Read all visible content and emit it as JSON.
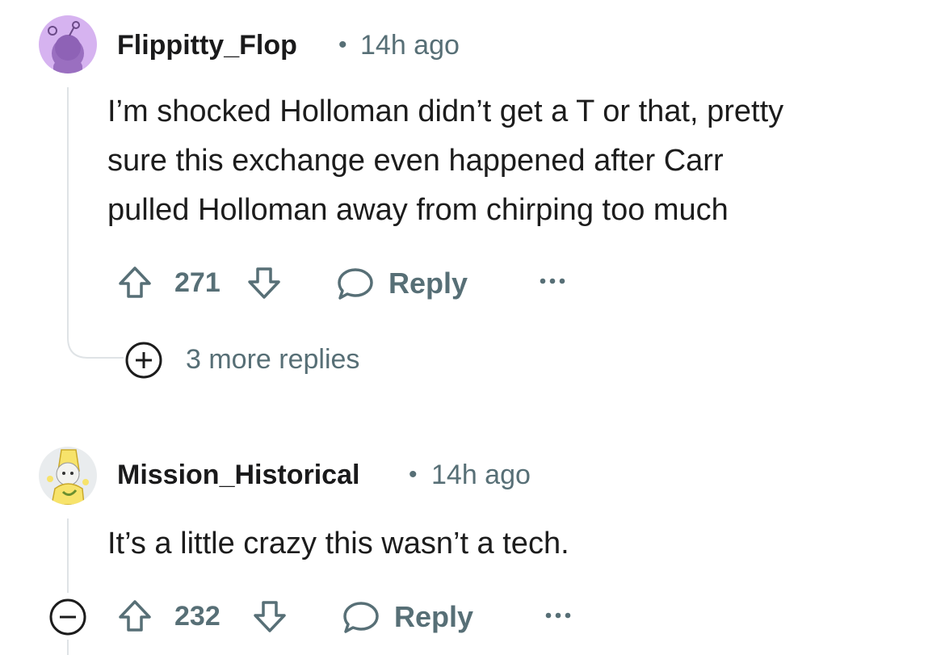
{
  "comments": [
    {
      "username": "Flippitty_Flop",
      "separator": "•",
      "time": "14h ago",
      "text_lines": [
        "I’m shocked Holloman didn’t get a T or that, pretty",
        "sure this exchange even happened after Carr",
        "pulled Holloman away from chirping too much"
      ],
      "score": "271",
      "reply_label": "Reply",
      "more_replies_label": "3 more replies",
      "avatar_icon": "snoo-avatar-icon",
      "avatar_color": "#d6b3f0"
    },
    {
      "username": "Mission_Historical",
      "separator": "•",
      "time": "14h ago",
      "text": "It’s a little crazy this wasn’t a tech.",
      "score": "232",
      "reply_label": "Reply",
      "avatar_icon": "banana-snoo-avatar-icon"
    }
  ],
  "icons": {
    "upvote": "arrow-up-outline-icon",
    "downvote": "arrow-down-outline-icon",
    "reply": "speech-bubble-icon",
    "overflow": "ellipsis-icon",
    "expand": "plus-circle-icon",
    "collapse": "minus-circle-icon"
  },
  "colors": {
    "meta_text": "#576f76",
    "thread_line": "#dfe3e6"
  }
}
